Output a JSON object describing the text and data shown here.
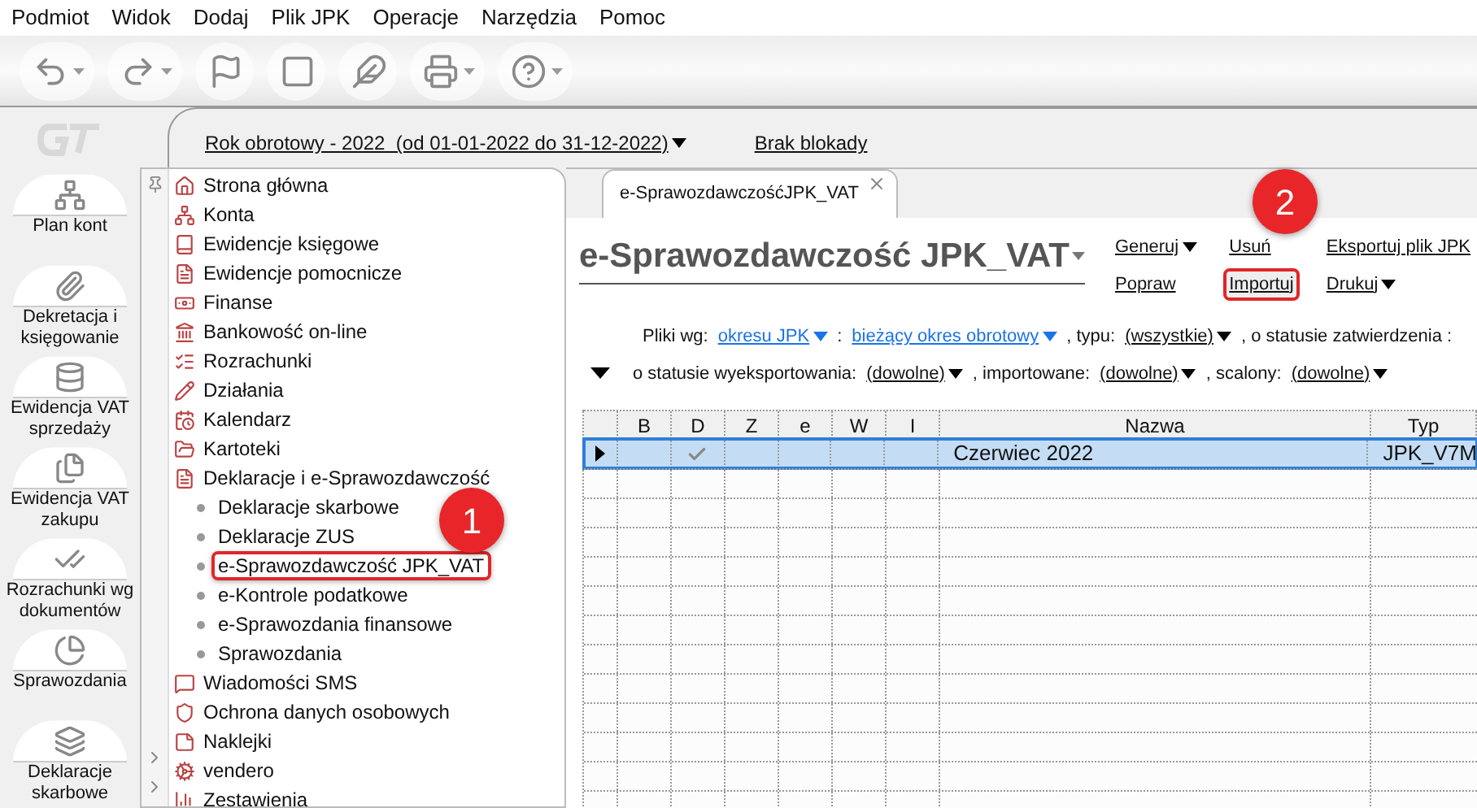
{
  "menu": [
    "Podmiot",
    "Widok",
    "Dodaj",
    "Plik JPK",
    "Operacje",
    "Narzędzia",
    "Pomoc"
  ],
  "nav_sidebar": {
    "items": [
      {
        "label": "Plan kont"
      },
      {
        "label": "Dekretacja i księgowanie"
      },
      {
        "label": "Ewidencja VAT sprzedaży"
      },
      {
        "label": "Ewidencja VAT zakupu"
      },
      {
        "label": "Rozrachunki wg dokumentów"
      },
      {
        "label": "Sprawozdania"
      },
      {
        "label": "Deklaracje skarbowe"
      }
    ]
  },
  "period_bar": {
    "fiscal_year": "Rok obrotowy - 2022  (od 01-01-2022 do 31-12-2022)",
    "lock": "Brak blokady"
  },
  "tree": [
    {
      "label": "Strona główna"
    },
    {
      "label": "Konta"
    },
    {
      "label": "Ewidencje księgowe"
    },
    {
      "label": "Ewidencje pomocnicze"
    },
    {
      "label": "Finanse"
    },
    {
      "label": "Bankowość on-line"
    },
    {
      "label": "Rozrachunki"
    },
    {
      "label": "Działania"
    },
    {
      "label": "Kalendarz"
    },
    {
      "label": "Kartoteki"
    },
    {
      "label": "Deklaracje i e-Sprawozdawczość",
      "expanded": true,
      "children": [
        {
          "label": "Deklaracje skarbowe",
          "highlighted": false
        },
        {
          "label": "Deklaracje ZUS",
          "highlighted": false
        },
        {
          "label": "e-Sprawozdawczość JPK_VAT",
          "highlighted": true
        },
        {
          "label": "e-Kontrole podatkowe",
          "highlighted": false
        },
        {
          "label": "e-Sprawozdania finansowe",
          "highlighted": false
        },
        {
          "label": "Sprawozdania",
          "highlighted": false
        }
      ]
    },
    {
      "label": "Wiadomości SMS"
    },
    {
      "label": "Ochrona danych osobowych"
    },
    {
      "label": "Naklejki"
    },
    {
      "label": "vendero",
      "expanded": false
    },
    {
      "label": "Zestawienia",
      "expanded": false
    }
  ],
  "tabs": [
    {
      "label": "e-SprawozdawczośćJPK_VAT",
      "selected": true
    }
  ],
  "heading": "e-Sprawozdawczość JPK_VAT",
  "actions": [
    {
      "label": "Generuj",
      "dropdown": true,
      "highlighted": false
    },
    {
      "label": "Usuń",
      "dropdown": false,
      "highlighted": false
    },
    {
      "label": "Eksportuj plik JPK",
      "dropdown": false,
      "highlighted": false
    },
    {
      "label": "Popraw",
      "dropdown": false,
      "highlighted": false
    },
    {
      "label": "Importuj",
      "dropdown": false,
      "highlighted": true
    },
    {
      "label": "Drukuj",
      "dropdown": true,
      "highlighted": false
    }
  ],
  "filters": [
    [
      {
        "kind": "text",
        "text": "Pliki wg:"
      },
      {
        "kind": "blue-link",
        "text": "okresu JPK"
      },
      {
        "kind": "text",
        "text": ":"
      },
      {
        "kind": "blue-link",
        "text": "bieżący okres obrotowy"
      },
      {
        "kind": "text",
        "text": ", typu:"
      },
      {
        "kind": "link",
        "text": "(wszystkie)"
      },
      {
        "kind": "text",
        "text": ", o statusie zatwierdzenia :"
      }
    ],
    [
      {
        "kind": "text",
        "text": "o statusie wyeksportowania:"
      },
      {
        "kind": "link",
        "text": "(dowolne)"
      },
      {
        "kind": "text",
        "text": ", importowane:"
      },
      {
        "kind": "link",
        "text": "(dowolne)"
      },
      {
        "kind": "text",
        "text": ", scalony:"
      },
      {
        "kind": "link",
        "text": "(dowolne)"
      }
    ]
  ],
  "table": {
    "columns": [
      "B",
      "D",
      "Z",
      "e",
      "W",
      "I",
      "Nazwa",
      "Typ"
    ],
    "rows": [
      {
        "selected": true,
        "d_checked": true,
        "nazwa": "Czerwiec 2022",
        "typ": "JPK_V7M"
      }
    ]
  },
  "annotations": [
    {
      "label": "1"
    },
    {
      "label": "2"
    }
  ]
}
